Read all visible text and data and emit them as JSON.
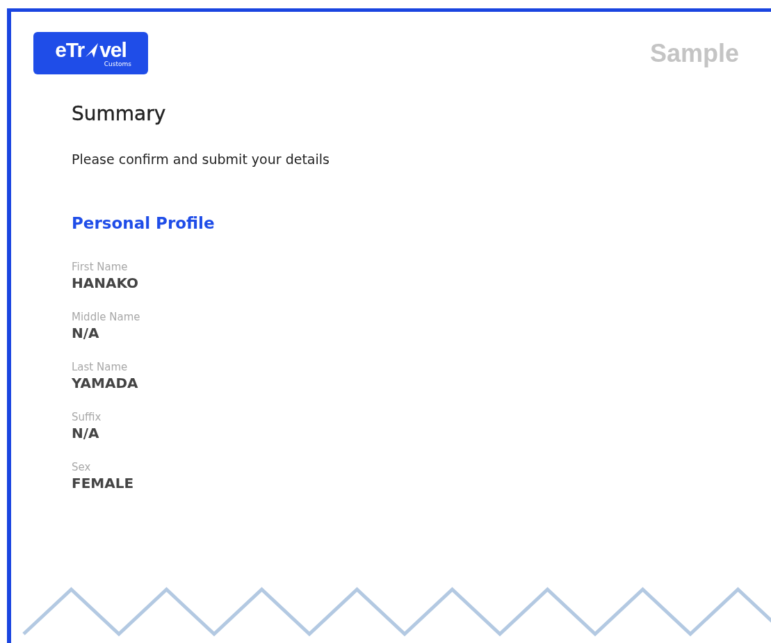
{
  "logo": {
    "text_before": "eTr",
    "text_after": "vel",
    "subtitle": "Customs"
  },
  "watermark": "Sample",
  "title": "Summary",
  "instruction": "Please confirm and submit your details",
  "section": {
    "title": "Personal Profile",
    "fields": [
      {
        "label": "First Name",
        "value": "HANAKO"
      },
      {
        "label": "Middle Name",
        "value": "N/A"
      },
      {
        "label": "Last Name",
        "value": "YAMADA"
      },
      {
        "label": "Suffix",
        "value": "N/A"
      },
      {
        "label": "Sex",
        "value": "FEMALE"
      }
    ]
  }
}
